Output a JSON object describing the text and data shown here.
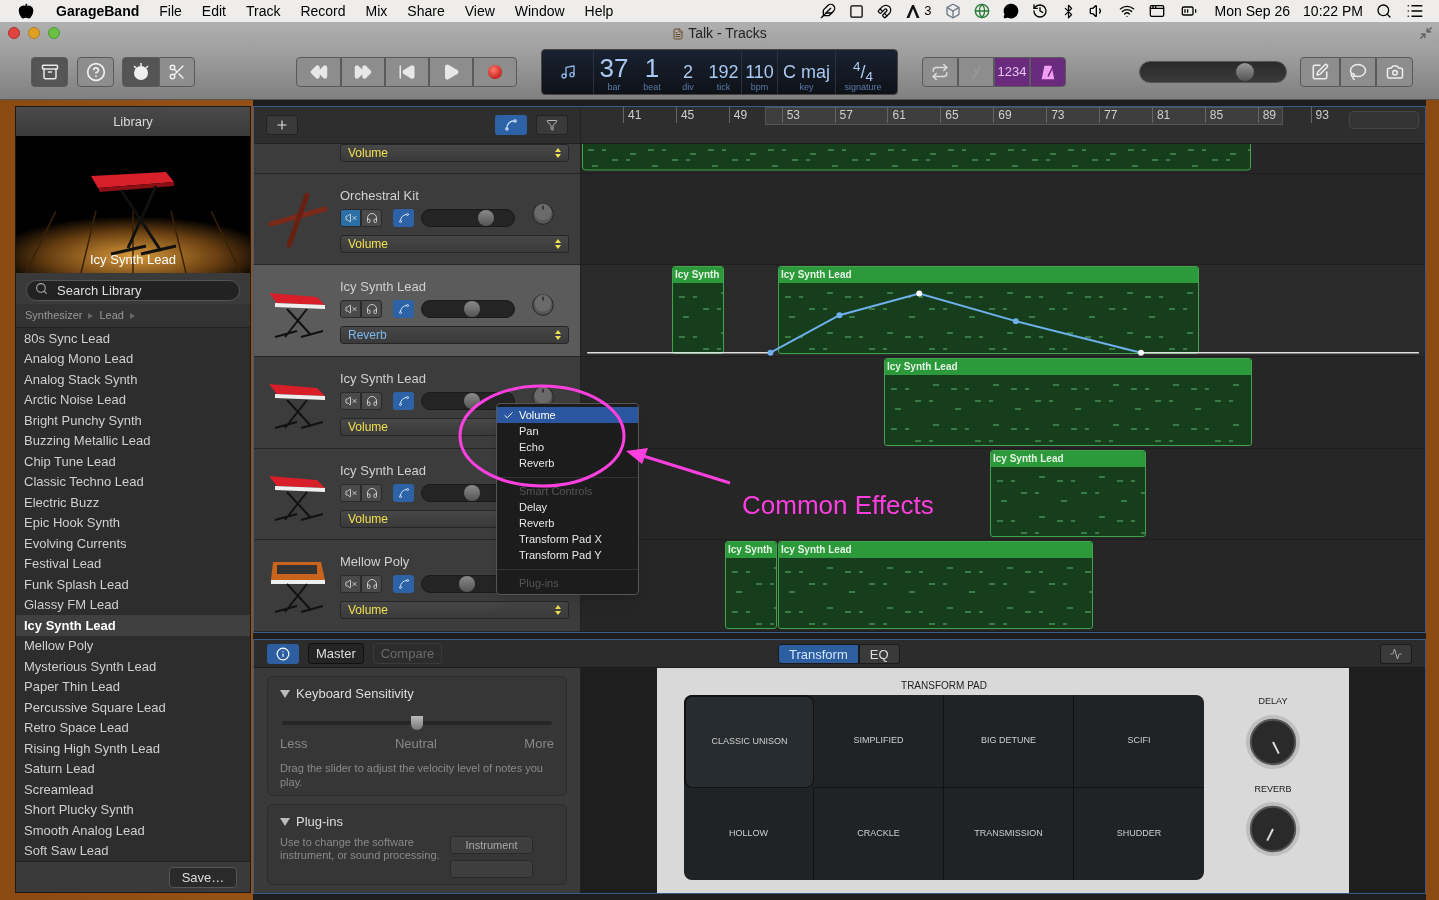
{
  "menubar": {
    "app": "GarageBand",
    "menus": [
      "File",
      "Edit",
      "Track",
      "Record",
      "Mix",
      "Share",
      "View",
      "Window",
      "Help"
    ],
    "status_badge": "3",
    "date": "Mon Sep 26",
    "time": "10:22 PM"
  },
  "window": {
    "title": "Talk - Tracks"
  },
  "toolbar": {
    "view_buttons": [
      {
        "kind": "library",
        "on": true
      },
      {
        "kind": "help",
        "on": false
      },
      {
        "kind": "smart_controls",
        "on": true
      },
      {
        "kind": "editors",
        "on": false
      }
    ],
    "lcd": [
      {
        "value": "37",
        "label": "bar"
      },
      {
        "value": "1",
        "label": "beat"
      },
      {
        "value": "2",
        "label": "div"
      },
      {
        "value": "192",
        "label": "tick"
      },
      {
        "value": "110",
        "label": "bpm"
      },
      {
        "value": "C maj",
        "label": "key"
      },
      {
        "value": "$^{4}$/$_{4}$",
        "label": "signature"
      }
    ],
    "mode_buttons": [
      {
        "kind": "cycle",
        "on": false
      },
      {
        "kind": "tuner",
        "on": false
      },
      {
        "kind": "count_in",
        "text": "1234",
        "on": true
      },
      {
        "kind": "metronome",
        "on": true
      }
    ],
    "master_volume": {
      "level": 0.72
    }
  },
  "library": {
    "title": "Library",
    "patch_name": "Icy Synth Lead",
    "search": {
      "placeholder": "Search Library"
    },
    "path": [
      "Synthesizer",
      "Lead"
    ],
    "patches": [
      {
        "name": "80s Sync Lead",
        "selected": false
      },
      {
        "name": "Analog Mono Lead",
        "selected": false
      },
      {
        "name": "Analog Stack Synth",
        "selected": false
      },
      {
        "name": "Arctic Noise Lead",
        "selected": false
      },
      {
        "name": "Bright Punchy Synth",
        "selected": false
      },
      {
        "name": "Buzzing Metallic Lead",
        "selected": false
      },
      {
        "name": "Chip Tune Lead",
        "selected": false
      },
      {
        "name": "Classic Techno Lead",
        "selected": false
      },
      {
        "name": "Electric Buzz",
        "selected": false
      },
      {
        "name": "Epic Hook Synth",
        "selected": false
      },
      {
        "name": "Evolving Currents",
        "selected": false
      },
      {
        "name": "Festival Lead",
        "selected": false
      },
      {
        "name": "Funk Splash Lead",
        "selected": false
      },
      {
        "name": "Glassy FM Lead",
        "selected": false
      },
      {
        "name": "Icy Synth Lead",
        "selected": true
      },
      {
        "name": "Mellow Poly",
        "selected": false
      },
      {
        "name": "Mysterious Synth Lead",
        "selected": false
      },
      {
        "name": "Paper Thin Lead",
        "selected": false
      },
      {
        "name": "Percussive Square Lead",
        "selected": false
      },
      {
        "name": "Retro Space Lead",
        "selected": false
      },
      {
        "name": "Rising High Synth Lead",
        "selected": false
      },
      {
        "name": "Saturn Lead",
        "selected": false
      },
      {
        "name": "Screamlead",
        "selected": false
      },
      {
        "name": "Short Plucky Synth",
        "selected": false
      },
      {
        "name": "Smooth Analog Lead",
        "selected": false
      },
      {
        "name": "Soft Saw Lead",
        "selected": false
      }
    ],
    "save_button": "Save…"
  },
  "clipped_track": {
    "automation": "Volume"
  },
  "tracks": [
    {
      "name": "Orchestral Kit",
      "kind": "drums",
      "selected": false,
      "muted": true,
      "level": 0.7,
      "automation": "Volume",
      "automation_shown": false
    },
    {
      "name": "Icy Synth Lead",
      "kind": "keyboard",
      "selected": true,
      "muted": false,
      "level": 0.54,
      "automation": "Reverb",
      "automation_shown": true,
      "regions": [
        {
          "title": "Icy Synth"
        },
        {
          "title": "Icy Synth Lead"
        }
      ]
    },
    {
      "name": "Icy Synth Lead",
      "kind": "keyboard",
      "selected": false,
      "muted": false,
      "level": 0.54,
      "automation": "Volume",
      "automation_shown": false,
      "regions": [
        {
          "title": "Icy Synth Lead"
        }
      ]
    },
    {
      "name": "Icy Synth Lead",
      "kind": "keyboard",
      "selected": false,
      "muted": false,
      "level": 0.54,
      "automation": "Volume",
      "automation_shown": false,
      "regions": [
        {
          "title": "Icy Synth Lead"
        }
      ]
    },
    {
      "name": "Mellow Poly",
      "kind": "synth",
      "selected": false,
      "muted": false,
      "level": 0.49,
      "automation": "Volume",
      "automation_shown": false,
      "regions": [
        {
          "title": "Icy Synth"
        },
        {
          "title": "Icy Synth Lead"
        }
      ]
    }
  ],
  "ruler": [
    "41",
    "45",
    "49",
    "53",
    "57",
    "61",
    "65",
    "69",
    "73",
    "77",
    "81",
    "85",
    "89",
    "93"
  ],
  "menu": {
    "items": [
      {
        "kind": "item",
        "text": "Volume",
        "checked": true,
        "selected": true
      },
      {
        "kind": "item",
        "text": "Pan",
        "checked": false,
        "selected": false
      },
      {
        "kind": "item",
        "text": "Echo",
        "checked": false,
        "selected": false
      },
      {
        "kind": "item",
        "text": "Reverb",
        "checked": false,
        "selected": false
      },
      {
        "kind": "separator"
      },
      {
        "kind": "header",
        "text": "Smart Controls"
      },
      {
        "kind": "item",
        "text": "Delay",
        "checked": false,
        "selected": false
      },
      {
        "kind": "item",
        "text": "Reverb",
        "checked": false,
        "selected": false
      },
      {
        "kind": "item",
        "text": "Transform Pad X",
        "checked": false,
        "selected": false
      },
      {
        "kind": "item",
        "text": "Transform Pad Y",
        "checked": false,
        "selected": false
      },
      {
        "kind": "separator"
      },
      {
        "kind": "header",
        "text": "Plug-ins"
      }
    ]
  },
  "annotation": {
    "text": "Common Effects"
  },
  "smart_controls": {
    "buttons": [
      {
        "kind": "info",
        "selected": true
      },
      {
        "kind": "text",
        "text": "Master",
        "disabled": false
      },
      {
        "kind": "text",
        "text": "Compare",
        "disabled": true
      }
    ],
    "tabs": [
      {
        "label": "Transform",
        "selected": true
      },
      {
        "label": "EQ",
        "selected": false
      }
    ],
    "sections": [
      {
        "kind": "slider",
        "title": "Keyboard Sensitivity",
        "expanded": true,
        "level": 0.5,
        "labels": [
          "Less",
          "Neutral",
          "More"
        ],
        "description": "Drag the slider to adjust the velocity level of notes you play."
      },
      {
        "kind": "plugins",
        "title": "Plug-ins",
        "expanded": true,
        "description": "Use to change the software instrument, or sound processing.",
        "button": "Instrument"
      }
    ],
    "transform_pad": {
      "title": "TRANSFORM PAD",
      "pads": [
        {
          "label": "CLASSIC UNISON",
          "selected": true
        },
        {
          "label": "SIMPLIFIED",
          "selected": false
        },
        {
          "label": "BIG DETUNE",
          "selected": false
        },
        {
          "label": "SCIFI",
          "selected": false
        },
        {
          "label": "HOLLOW",
          "selected": false
        },
        {
          "label": "CRACKLE",
          "selected": false
        },
        {
          "label": "TRANSMISSION",
          "selected": false
        },
        {
          "label": "SHUDDER",
          "selected": false
        }
      ],
      "knobs": [
        {
          "label": "DELAY"
        },
        {
          "label": "REVERB"
        }
      ]
    }
  }
}
